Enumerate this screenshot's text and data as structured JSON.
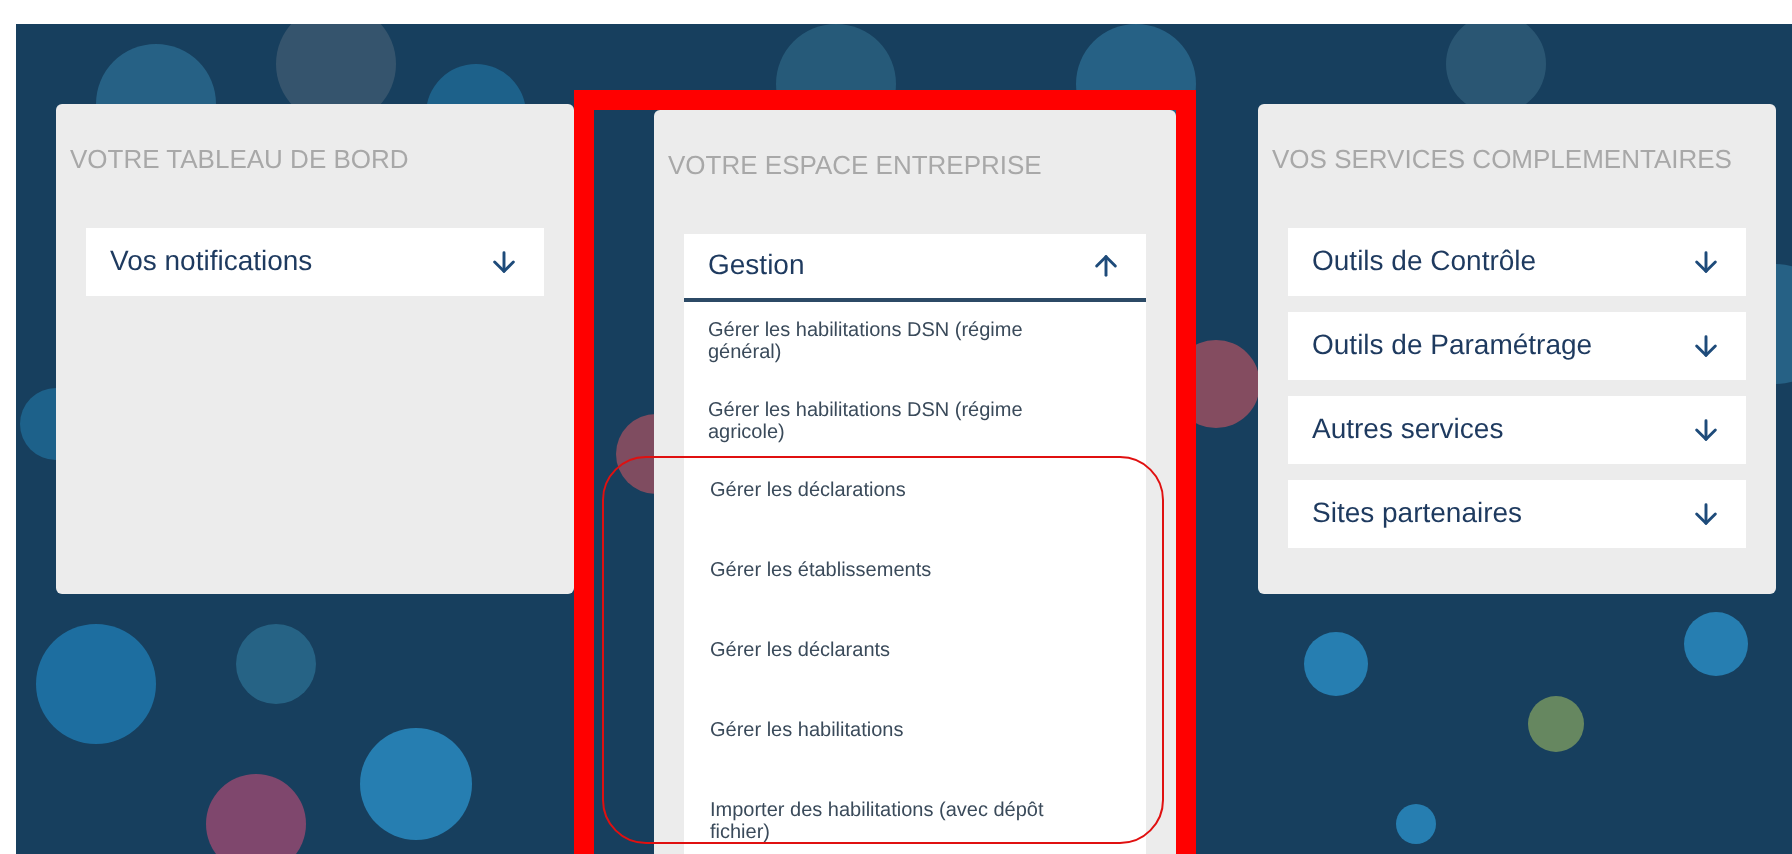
{
  "panels": [
    {
      "title": "VOTRE TABLEAU DE BORD",
      "highlighted": false,
      "sections": [
        {
          "label": "Vos notifications",
          "expanded": false
        }
      ]
    },
    {
      "title": "VOTRE ESPACE ENTREPRISE",
      "highlighted": true,
      "sections": [
        {
          "label": "Gestion",
          "expanded": true,
          "links": [
            {
              "label": "Gérer les habilitations DSN (régime général)",
              "circled": false
            },
            {
              "label": "Gérer les habilitations DSN (régime agricole)",
              "circled": false
            },
            {
              "label": "Gérer les déclarations",
              "circled": true
            },
            {
              "label": "Gérer les établissements",
              "circled": true
            },
            {
              "label": "Gérer les déclarants",
              "circled": true
            },
            {
              "label": "Gérer les habilitations",
              "circled": true
            },
            {
              "label": "Importer des habilitations (avec dépôt fichier)",
              "circled": true
            }
          ]
        }
      ]
    },
    {
      "title": "VOS SERVICES COMPLEMENTAIRES",
      "highlighted": false,
      "sections": [
        {
          "label": "Outils de Contrôle",
          "expanded": false
        },
        {
          "label": "Outils de Paramétrage",
          "expanded": false
        },
        {
          "label": "Autres services",
          "expanded": false
        },
        {
          "label": "Sites partenaires",
          "expanded": false
        }
      ]
    }
  ]
}
